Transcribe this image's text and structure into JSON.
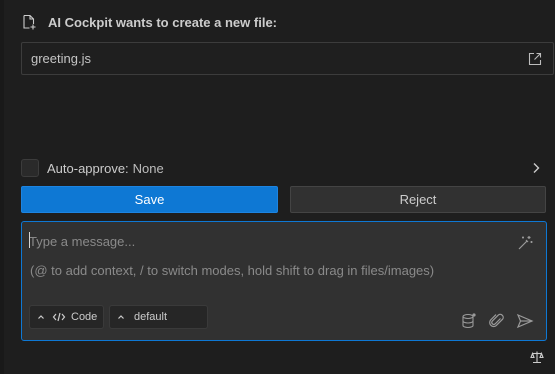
{
  "header": {
    "title": "AI Cockpit wants to create a new file:",
    "icon": "new-file-icon"
  },
  "file": {
    "name": "greeting.js",
    "action_icon": "open-external-icon"
  },
  "auto_approve": {
    "label": "Auto-approve:",
    "value": "None",
    "checked": false
  },
  "buttons": {
    "save": "Save",
    "reject": "Reject"
  },
  "composer": {
    "placeholder": "Type a message...",
    "hint": "(@ to add context, / to switch modes, hold shift to drag in files/images)",
    "mode_label": "Code",
    "profile_label": "default"
  },
  "colors": {
    "accent": "#0e78d4",
    "background": "#1e1e1e",
    "panel": "#313131"
  }
}
